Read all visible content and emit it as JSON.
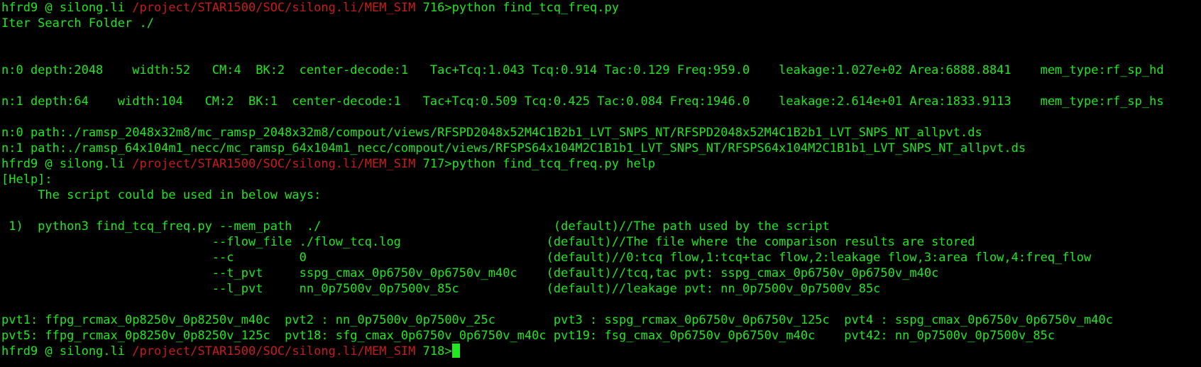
{
  "colors": {
    "background": "#000000",
    "text": "#21e621",
    "path": "#c81c1c",
    "cursor": "#21e621"
  },
  "prompt": {
    "user_host": "hfrd9 @ silong.li ",
    "cwd": "/project/STAR1500/SOC/silong.li/MEM_SIM"
  },
  "session": [
    {
      "type": "prompt",
      "num": " 716>",
      "cmd": "python find_tcq_freq.py"
    },
    {
      "type": "text",
      "text": "Iter Search Folder ./"
    },
    {
      "type": "text",
      "text": ""
    },
    {
      "type": "text",
      "text": ""
    },
    {
      "type": "text",
      "text": "n:0 depth:2048    width:52   CM:4  BK:2  center-decode:1   Tac+Tcq:1.043 Tcq:0.914 Tac:0.129 Freq:959.0    leakage:1.027e+02 Area:6888.8841    mem_type:rf_sp_hd"
    },
    {
      "type": "text",
      "text": ""
    },
    {
      "type": "text",
      "text": "n:1 depth:64    width:104   CM:2  BK:1  center-decode:1   Tac+Tcq:0.509 Tcq:0.425 Tac:0.084 Freq:1946.0    leakage:2.614e+01 Area:1833.9113    mem_type:rf_sp_hs"
    },
    {
      "type": "text",
      "text": ""
    },
    {
      "type": "text",
      "text": "n:0 path:./ramsp_2048x32m8/mc_ramsp_2048x32m8/compout/views/RFSPD2048x52M4C1B2b1_LVT_SNPS_NT/RFSPD2048x52M4C1B2b1_LVT_SNPS_NT_allpvt.ds"
    },
    {
      "type": "text",
      "text": "n:1 path:./ramsp_64x104m1_necc/mc_ramsp_64x104m1_necc/compout/views/RFSPS64x104M2C1B1b1_LVT_SNPS_NT/RFSPS64x104M2C1B1b1_LVT_SNPS_NT_allpvt.ds"
    },
    {
      "type": "prompt",
      "num": " 717>",
      "cmd": "python find_tcq_freq.py help"
    },
    {
      "type": "text",
      "text": "[Help]:"
    },
    {
      "type": "text",
      "text": "     The script could be used in below ways:"
    },
    {
      "type": "text",
      "text": ""
    },
    {
      "type": "text",
      "text": " 1)  python3 find_tcq_freq.py --mem_path  ./                                (default)//The path used by the script"
    },
    {
      "type": "text",
      "text": "                             --flow_file ./flow_tcq.log                    (default)//The file where the comparison results are stored"
    },
    {
      "type": "text",
      "text": "                             --c         0                                 (default)//0:tcq flow,1:tcq+tac flow,2:leakage flow,3:area flow,4:freq_flow"
    },
    {
      "type": "text",
      "text": "                             --t_pvt     sspg_cmax_0p6750v_0p6750v_m40c    (default)//tcq,tac pvt: sspg_cmax_0p6750v_0p6750v_m40c"
    },
    {
      "type": "text",
      "text": "                             --l_pvt     nn_0p7500v_0p7500v_85c            (default)//leakage pvt: nn_0p7500v_0p7500v_85c"
    },
    {
      "type": "text",
      "text": ""
    },
    {
      "type": "text",
      "text": "pvt1: ffpg_rcmax_0p8250v_0p8250v_m40c  pvt2 : nn_0p7500v_0p7500v_25c        pvt3 : sspg_rcmax_0p6750v_0p6750v_125c  pvt4 : sspg_cmax_0p6750v_0p6750v_m40c"
    },
    {
      "type": "text",
      "text": "pvt5: ffpg_rcmax_0p8250v_0p8250v_125c  pvt18: sfg_cmax_0p6750v_0p6750v_m40c pvt19: fsg_cmax_0p6750v_0p6750v_m40c    pvt42: nn_0p7500v_0p7500v_85c"
    },
    {
      "type": "prompt",
      "num": " 718>",
      "cmd": "",
      "cursor": true
    }
  ]
}
